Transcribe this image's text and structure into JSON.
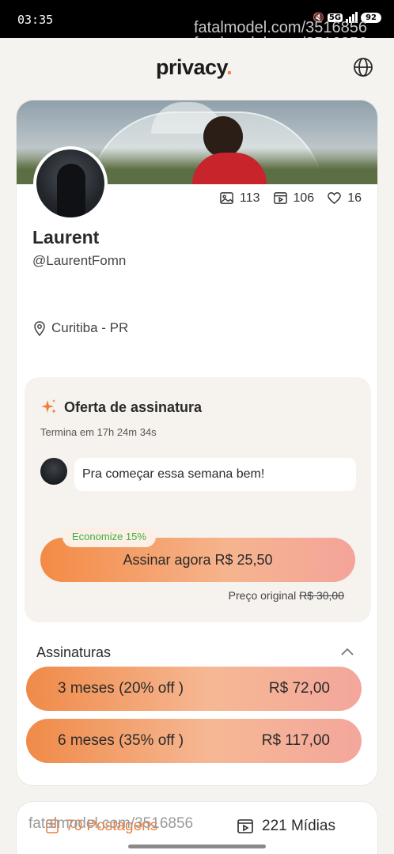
{
  "status_bar": {
    "time": "03:35",
    "network": "5G",
    "battery": "92"
  },
  "watermark": "fatalmodel.com/3516856",
  "header": {
    "logo_text": "privacy",
    "logo_dot": "."
  },
  "profile": {
    "name": "Laurent",
    "handle": "@LaurentFomn",
    "location": "Curitiba - PR",
    "stats": {
      "images": "113",
      "videos": "106",
      "likes": "16"
    }
  },
  "offer": {
    "title": "Oferta de assinatura",
    "ends": "Termina em 17h 24m 34s",
    "message": "Pra começar essa semana bem!",
    "save_badge": "Economize 15%",
    "subscribe_label": "Assinar agora R$ 25,50",
    "original_price_label": "Preço original",
    "original_price": "R$ 30,00"
  },
  "subscriptions": {
    "title": "Assinaturas",
    "plans": [
      {
        "label": "3 meses (20% off )",
        "price": "R$ 72,00"
      },
      {
        "label": "6 meses (35% off )",
        "price": "R$ 117,00"
      }
    ]
  },
  "bottom_tabs": {
    "posts": "70 Postagens",
    "media": "221 Mídias"
  },
  "colors": {
    "accent": "#f0803c",
    "save_green": "#3cb043"
  }
}
